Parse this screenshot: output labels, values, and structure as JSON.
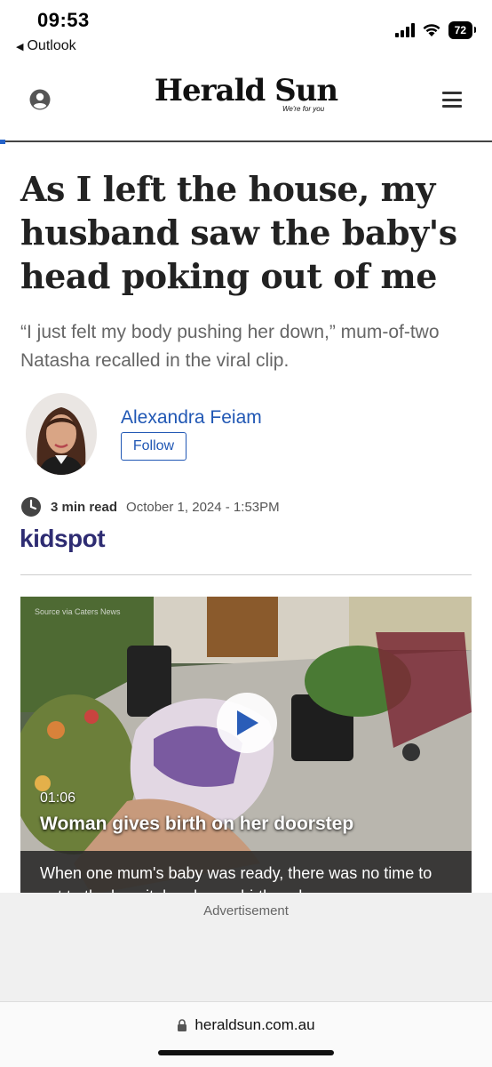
{
  "status_bar": {
    "time": "09:53",
    "back_app": "Outlook",
    "battery": "72"
  },
  "header": {
    "brand": "Herald Sun",
    "tagline": "We're for you",
    "icons": [
      "user-icon",
      "menu-icon"
    ]
  },
  "reading_progress": 0.01,
  "article": {
    "headline": "As I left the house, my husband saw the baby's head poking out of me",
    "standfirst": "“I just felt my body pushing her down,” mum-of-two Natasha recalled in the viral clip.",
    "author": {
      "name": "Alexandra Feiam",
      "follow_label": "Follow"
    },
    "read_time": "3 min read",
    "date": "October 1, 2024 - 1:53PM",
    "source_brand": "kidspot"
  },
  "video": {
    "source_credit": "Source via Caters News",
    "duration": "01:06",
    "title": "Woman gives birth on her doorstep",
    "caption": "When one mum's baby was ready, there was no time to get to the hospital and gave birth on her"
  },
  "advertisement": {
    "label": "Advertisement"
  },
  "browser": {
    "url": "heraldsun.com.au"
  },
  "colors": {
    "link_blue": "#2057b4",
    "kidspot_navy": "#2e2c72",
    "progress_blue": "#2563c9"
  }
}
